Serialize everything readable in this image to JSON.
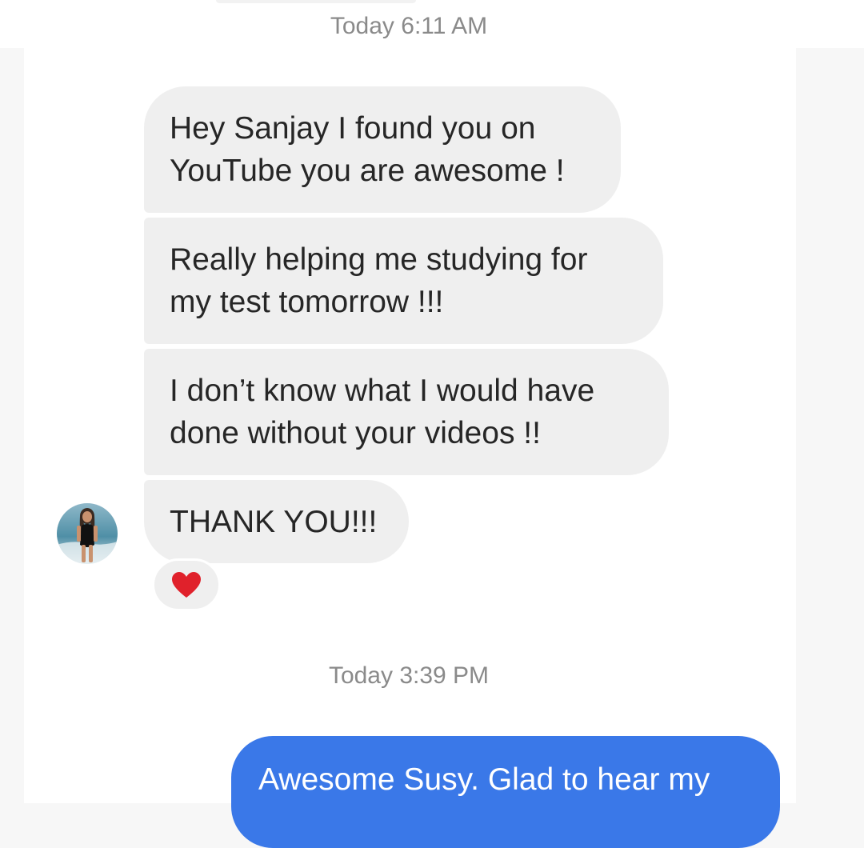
{
  "thread": {
    "timestamp_1": "Today 6:11 AM",
    "timestamp_2": "Today 3:39 PM",
    "received": [
      {
        "text": "Hey Sanjay I found you on\nYouTube you are awesome !"
      },
      {
        "text": "Really helping me studying for\nmy test tomorrow !!!"
      },
      {
        "text": "I don’t know what I would have\ndone without your videos !!"
      },
      {
        "text": "THANK YOU!!!"
      }
    ],
    "reaction": {
      "icon": "heart-icon",
      "color": "#e0212b"
    },
    "sent": [
      {
        "text": "Awesome Susy. Glad to hear my"
      }
    ]
  },
  "colors": {
    "received_bubble": "#efefef",
    "sent_bubble": "#3a78e8",
    "timestamp": "#8a8a8a"
  }
}
